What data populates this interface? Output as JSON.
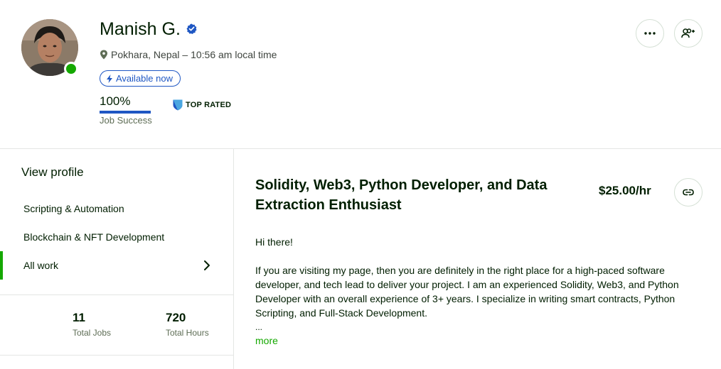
{
  "profile": {
    "name": "Manish G.",
    "location": "Pokhara, Nepal – 10:56 am local time",
    "availability": "Available now",
    "job_success_value": "100%",
    "job_success_percent": 100,
    "job_success_label": "Job Success",
    "badge": "TOP RATED"
  },
  "sidebar": {
    "view_profile": "View profile",
    "items": [
      {
        "label": "Scripting & Automation"
      },
      {
        "label": "Blockchain & NFT Development"
      },
      {
        "label": "All work"
      }
    ],
    "stats": [
      {
        "value": "11",
        "label": "Total Jobs"
      },
      {
        "value": "720",
        "label": "Total Hours"
      }
    ]
  },
  "main": {
    "title": "Solidity, Web3, Python Developer, and Data Extraction Enthusiast",
    "rate": "$25.00/hr",
    "description": [
      "Hi there!",
      "If you are visiting my page, then you are definitely in the right place for a high-paced software developer, and tech lead to deliver your project. I am an experienced Solidity, Web3, and Python Developer with an overall experience of 3+ years. I specialize in writing smart contracts, Python Scripting, and Full-Stack Development."
    ],
    "ellipsis": "...",
    "more_label": "more"
  },
  "colors": {
    "accent_green": "#14a800",
    "accent_blue": "#1f57c3",
    "text": "#001e00",
    "muted": "#5e6d55",
    "border": "#e4e6e4"
  },
  "icons": {
    "location": "location-pin-icon",
    "verified": "verified-badge-icon",
    "available": "lightning-icon",
    "top_rated": "top-rated-shield-icon",
    "more": "more-dots-icon",
    "follow": "add-user-icon",
    "link": "link-icon",
    "chevron": "chevron-right-icon"
  }
}
